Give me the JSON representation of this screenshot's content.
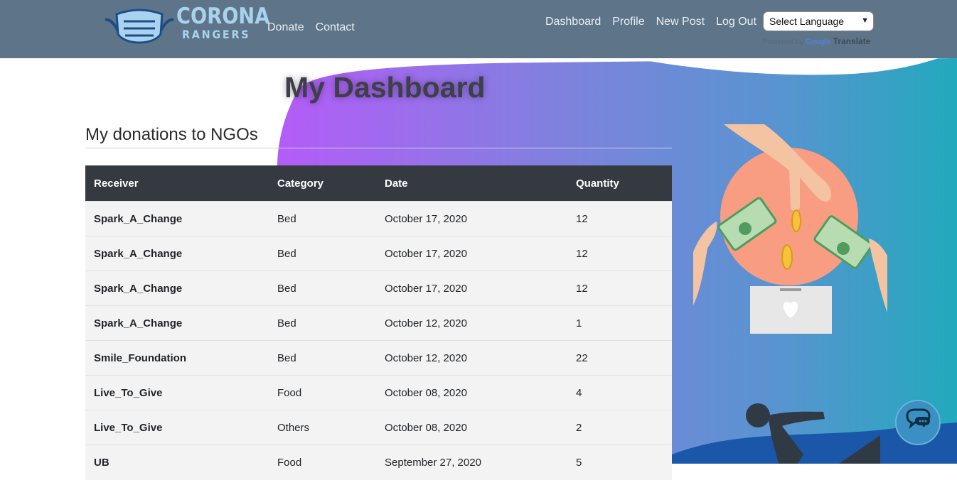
{
  "brand": {
    "line1": "CORONA",
    "line2": "RANGERS"
  },
  "nav": {
    "left": [
      {
        "label": "Donate"
      },
      {
        "label": "Contact"
      }
    ],
    "right": [
      {
        "label": "Dashboard"
      },
      {
        "label": "Profile"
      },
      {
        "label": "New Post"
      },
      {
        "label": "Log Out"
      }
    ],
    "language_select": "Select Language",
    "powered_by": "Powered by",
    "google": "Google",
    "translate": "Translate"
  },
  "page": {
    "title": "My Dashboard",
    "section_title": "My donations to NGOs"
  },
  "table": {
    "headers": [
      "Receiver",
      "Category",
      "Date",
      "Quantity"
    ],
    "rows": [
      [
        "Spark_A_Change",
        "Bed",
        "October 17, 2020",
        "12"
      ],
      [
        "Spark_A_Change",
        "Bed",
        "October 17, 2020",
        "12"
      ],
      [
        "Spark_A_Change",
        "Bed",
        "October 17, 2020",
        "12"
      ],
      [
        "Spark_A_Change",
        "Bed",
        "October 12, 2020",
        "1"
      ],
      [
        "Smile_Foundation",
        "Bed",
        "October 12, 2020",
        "22"
      ],
      [
        "Live_To_Give",
        "Food",
        "October 08, 2020",
        "4"
      ],
      [
        "Live_To_Give",
        "Others",
        "October 08, 2020",
        "2"
      ],
      [
        "UB",
        "Food",
        "September 27, 2020",
        "5"
      ]
    ]
  },
  "colors": {
    "navbar": "#5e7589",
    "brand": "#a9d2ee",
    "table_header": "#343a40",
    "blob_purple": "#a65cf7",
    "blob_teal": "#26a9be",
    "chat_button": "#3a90c2"
  },
  "icons": {
    "logo": "face-mask-icon",
    "chat": "chat-bubbles-icon"
  }
}
